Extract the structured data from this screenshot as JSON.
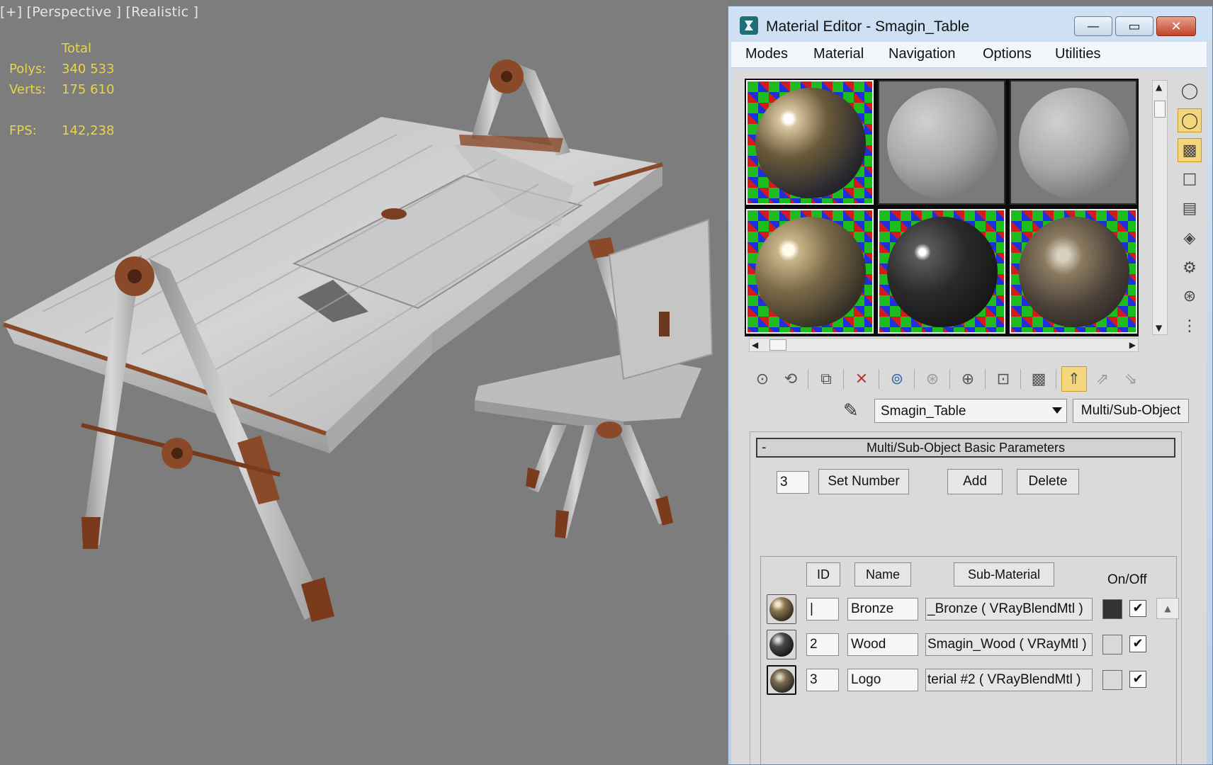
{
  "viewport": {
    "label": "[+] [Perspective ] [Realistic ]",
    "stats": {
      "total_label": "Total",
      "polys_label": "Polys:",
      "polys_value": "340 533",
      "verts_label": "Verts:",
      "verts_value": "175 610",
      "fps_label": "FPS:",
      "fps_value": "142,238"
    }
  },
  "editor": {
    "title": "Material Editor - Smagin_Table",
    "window_buttons": {
      "minimize": "—",
      "restore": "▭",
      "close": "✕"
    },
    "menu": [
      "Modes",
      "Material",
      "Navigation",
      "Options",
      "Utilities"
    ],
    "material_name": "Smagin_Table",
    "material_type": "Multi/Sub-Object",
    "rollout": {
      "collapse": "-",
      "title": "Multi/Sub-Object Basic Parameters",
      "count": "3",
      "set_number": "Set Number",
      "add": "Add",
      "delete": "Delete",
      "headers": {
        "id": "ID",
        "name": "Name",
        "sub_material": "Sub-Material",
        "on_off": "On/Off"
      },
      "rows": [
        {
          "id": "|",
          "name": "Bronze",
          "sub_material": "_Bronze  ( VRayBlendMtl )",
          "color": "#333333",
          "checked": "✔"
        },
        {
          "id": "2",
          "name": "Wood",
          "sub_material": "Smagin_Wood  ( VRayMtl )",
          "color": "#d9d9d9",
          "checked": "✔"
        },
        {
          "id": "3",
          "name": "Logo",
          "sub_material": "terial #2  ( VRayBlendMtl )",
          "color": "#d9d9d9",
          "checked": "✔"
        }
      ]
    }
  },
  "colors": {
    "titlebar": "#c7d9ee",
    "highlight": "#f3d67d",
    "viewport_bg": "#7d7d7d",
    "stats_text": "#e8d54a"
  }
}
